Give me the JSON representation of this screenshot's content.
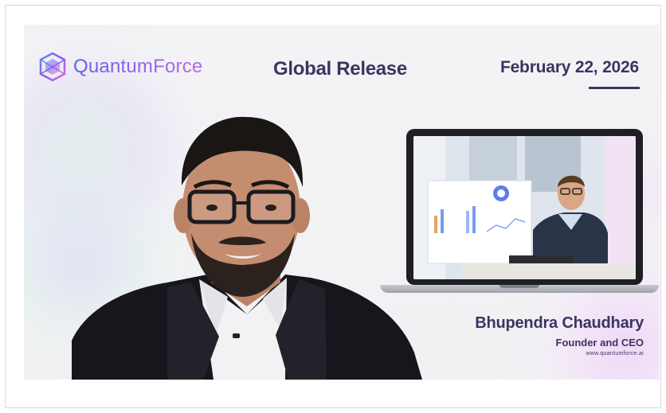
{
  "brand": {
    "name": "QuantumForce",
    "logo_icon": "quantum-cube-icon",
    "gradient": [
      "#6c5ce7",
      "#b86bf0"
    ]
  },
  "headline": "Global Release",
  "date": "February 22, 2026",
  "person": {
    "name": "Bhupendra Chaudhary",
    "role": "Founder and CEO",
    "website": "www.quantumforce.ai"
  },
  "colors": {
    "text_primary": "#3a3560",
    "background": "#f2f2f4"
  }
}
